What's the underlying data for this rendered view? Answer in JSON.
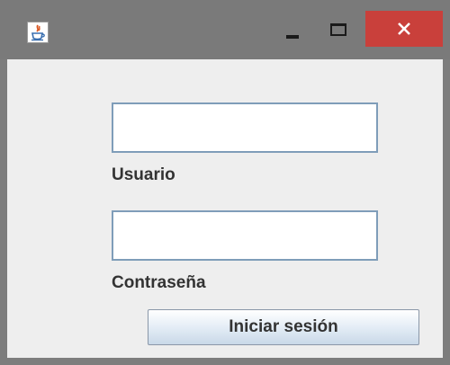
{
  "window": {
    "controls": {
      "minimize_icon": "minimize-icon",
      "maximize_icon": "maximize-icon",
      "close_icon": "close-icon"
    },
    "app_icon": "java-icon",
    "colors": {
      "titlebar": "#7a7a7a",
      "close_button": "#c9403b",
      "content_background": "#eeeeee",
      "field_border": "#7f9db9"
    }
  },
  "form": {
    "username": {
      "label": "Usuario",
      "value": "",
      "placeholder": ""
    },
    "password": {
      "label": "Contraseña",
      "value": "",
      "placeholder": ""
    },
    "submit_label": "Iniciar sesión"
  }
}
